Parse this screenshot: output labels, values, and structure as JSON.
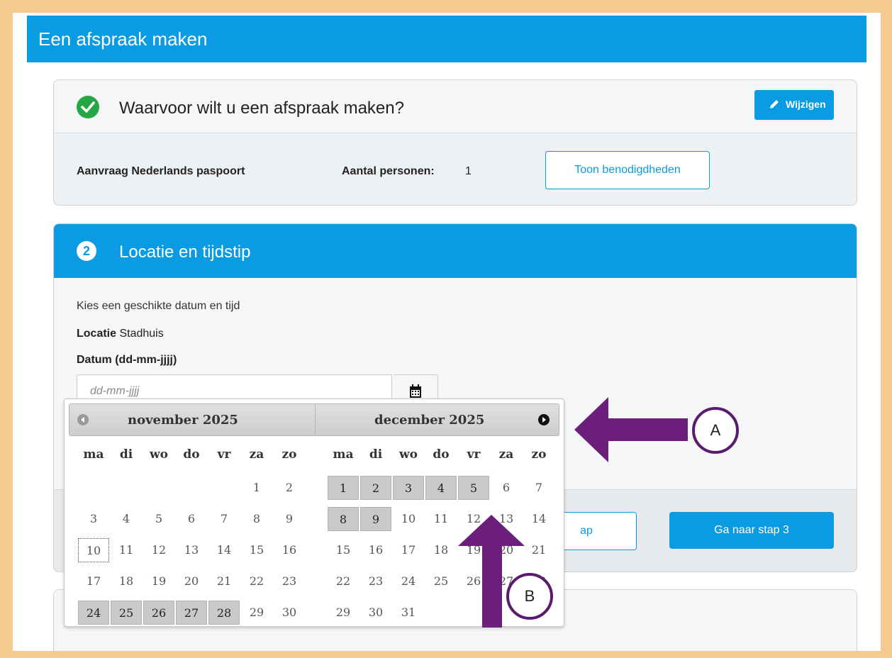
{
  "page": {
    "title": "Een afspraak maken"
  },
  "step1": {
    "title": "Waarvoor wilt u een afspraak maken?",
    "edit_label": "Wijzigen",
    "service": "Aanvraag Nederlands paspoort",
    "count_label": "Aantal personen:",
    "count_value": "1",
    "requirements_button": "Toon benodigdheden"
  },
  "step2": {
    "number": "2",
    "title": "Locatie en tijdstip",
    "intro": "Kies een geschikte datum en tijd",
    "location_label": "Locatie",
    "location_value": "Stadhuis",
    "date_label": "Datum (dd-mm-jjjj)",
    "date_placeholder": "dd-mm-jjjj",
    "prev_button": "ap",
    "next_button": "Ga naar stap 3"
  },
  "datepicker": {
    "months": [
      {
        "label": "november 2025",
        "first_weekday": 5,
        "days": 30,
        "available": [
          24,
          25,
          26,
          27,
          28
        ],
        "today": 10
      },
      {
        "label": "december 2025",
        "first_weekday": 0,
        "days": 31,
        "available": [
          1,
          2,
          3,
          4,
          5,
          8,
          9
        ],
        "today": null
      }
    ],
    "weekdays": [
      "ma",
      "di",
      "wo",
      "do",
      "vr",
      "za",
      "zo"
    ]
  },
  "annotations": {
    "marker_a": "A",
    "marker_b": "B",
    "color": "#6b1f7a"
  }
}
